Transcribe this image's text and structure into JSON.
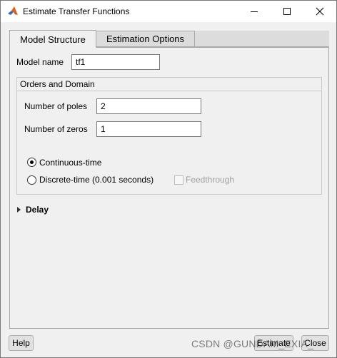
{
  "window": {
    "title": "Estimate Transfer Functions"
  },
  "tabs": [
    {
      "label": "Model Structure"
    },
    {
      "label": "Estimation Options"
    }
  ],
  "model": {
    "name_label": "Model name",
    "name_value": "tf1"
  },
  "orders": {
    "group_title": "Orders and Domain",
    "poles_label": "Number of poles",
    "poles_value": "2",
    "zeros_label": "Number of zeros",
    "zeros_value": "1",
    "continuous_label": "Continuous-time",
    "continuous_selected": true,
    "discrete_label": "Discrete-time (0.001 seconds)",
    "discrete_selected": false,
    "feedthrough_label": "Feedthrough",
    "feedthrough_checked": false
  },
  "delay": {
    "label": "Delay"
  },
  "buttons": {
    "help": "Help",
    "estimate": "Estimate",
    "close": "Close"
  },
  "watermark": "CSDN @GUNDAM_EXIA_",
  "colors": {
    "window_bg": "#f0f0f0",
    "titlebar_bg": "#ffffff",
    "tab_inactive_bg": "#dcdcdc"
  }
}
